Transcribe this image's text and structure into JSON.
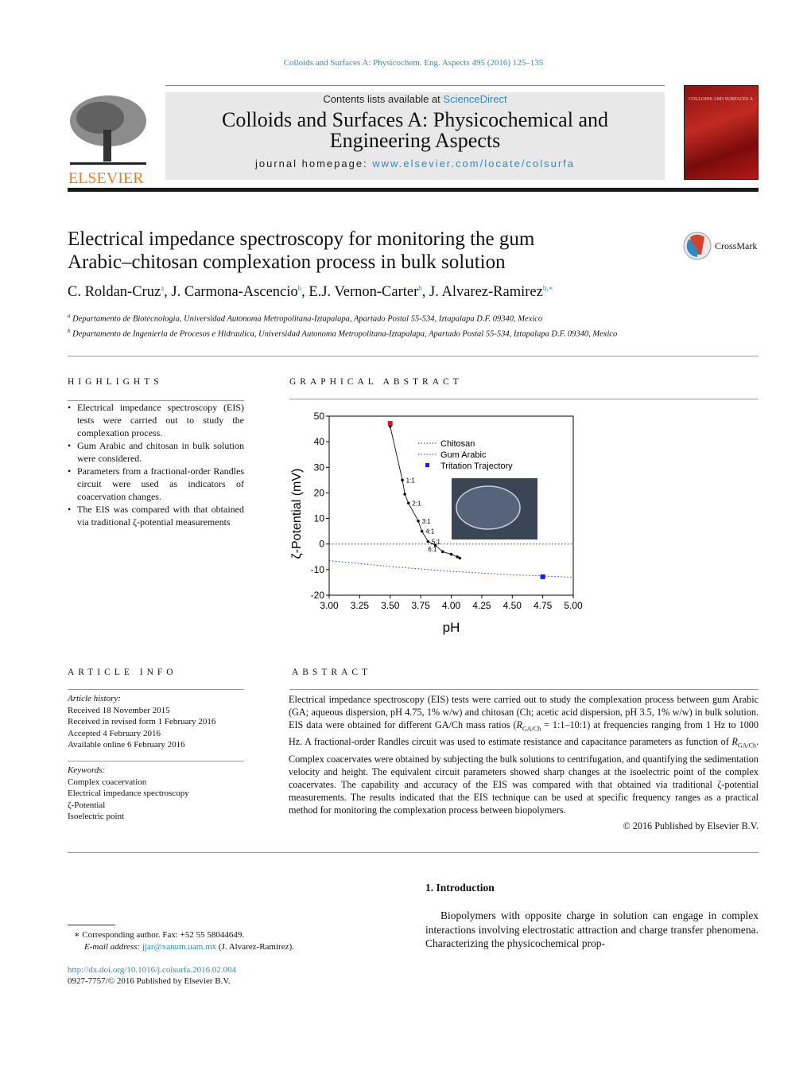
{
  "running_header": "Colloids and Surfaces A: Physicochem. Eng. Aspects 495 (2016) 125–135",
  "masthead": {
    "contents_prefix": "Contents lists available at ",
    "sciencedirect": "ScienceDirect",
    "journal_title_line1": "Colloids and Surfaces A: Physicochemical and",
    "journal_title_line2": "Engineering Aspects",
    "homepage_prefix": "journal homepage: ",
    "homepage_url": "www.elsevier.com/locate/colsurfa",
    "publisher_logo": "ELSEVIER",
    "cover_title": "COLLOIDS AND SURFACES A"
  },
  "crossmark": "CrossMark",
  "article": {
    "title_line1": "Electrical impedance spectroscopy for monitoring the gum",
    "title_line2": "Arabic–chitosan complexation process in bulk solution",
    "authors": [
      {
        "name": "C. Roldan-Cruz",
        "aff": "a",
        "sep": ", "
      },
      {
        "name": "J. Carmona-Ascencio",
        "aff": "b",
        "sep": ", "
      },
      {
        "name": "E.J. Vernon-Carter",
        "aff": "b",
        "sep": ", "
      },
      {
        "name": "J. Alvarez-Ramirez",
        "aff": "b,∗",
        "sep": ""
      }
    ],
    "affiliations": [
      {
        "mark": "a",
        "text": "Departamento de Biotecnologia, Universidad Autonoma Metropolitana-Iztapalapa, Apartado Postal 55-534, Iztapalapa D.F. 09340, Mexico"
      },
      {
        "mark": "b",
        "text": "Departamento de Ingenieria de Procesos e Hidraulica, Universidad Autonoma Metropolitana-Iztapalapa, Apartado Postal 55-534, Iztapalapa D.F. 09340, Mexico"
      }
    ]
  },
  "highlights": {
    "heading": "HIGHLIGHTS",
    "items": [
      "Electrical impedance spectroscopy (EIS) tests were carried out to study the complexation process.",
      "Gum Arabic and chitosan in bulk solution were considered.",
      "Parameters from a fractional-order Randles circuit were used as indicators of coacervation changes.",
      "The EIS was compared with that obtained via traditional ζ-potential measurements"
    ]
  },
  "graphical_abstract": {
    "heading": "GRAPHICAL ABSTRACT"
  },
  "chart_data": {
    "type": "line",
    "xlabel": "pH",
    "ylabel": "ζ-Potential (mV)",
    "xlim": [
      3.0,
      5.0
    ],
    "ylim": [
      -20,
      50
    ],
    "xticks": [
      "3.00",
      "3.25",
      "3.50",
      "3.75",
      "4.00",
      "4.25",
      "4.50",
      "4.75",
      "5.00"
    ],
    "yticks": [
      "50",
      "40",
      "30",
      "20",
      "10",
      "0",
      "-10",
      "-20"
    ],
    "grid": false,
    "legend_placement": "top-right",
    "legend": [
      "Chitosan",
      "Gum Arabic",
      "Tritation Trajectory"
    ],
    "series": [
      {
        "name": "Chitosan",
        "style": "dotted",
        "color": "#333333",
        "x": [
          3.0,
          5.0
        ],
        "y": [
          0,
          0
        ]
      },
      {
        "name": "Gum Arabic",
        "style": "dotted",
        "color": "#2233dd",
        "x": [
          3.0,
          3.5,
          4.0,
          4.5,
          5.0
        ],
        "y": [
          -6.5,
          -8.8,
          -10.7,
          -12.0,
          -13.0
        ]
      },
      {
        "name": "Tritation Trajectory",
        "color": "#1a1aee",
        "x": [
          4.75
        ],
        "y": [
          -12.8
        ]
      },
      {
        "name": "chitosan start",
        "color": "#ee1111",
        "x": [
          3.5
        ],
        "y": [
          47.2
        ]
      },
      {
        "style": "solid",
        "color": "#111111",
        "x": [
          3.5,
          3.6,
          3.62,
          3.65,
          3.73,
          3.76,
          3.81,
          3.87,
          3.93,
          4.0,
          4.05,
          4.07
        ],
        "y": [
          46,
          25,
          19.5,
          16,
          9,
          5,
          1,
          -0.5,
          -3,
          -4,
          -5,
          -5.5
        ]
      }
    ],
    "annotations": [
      {
        "text": "1:1",
        "x": 3.61,
        "y": 25
      },
      {
        "text": "2:1",
        "x": 3.66,
        "y": 16
      },
      {
        "text": "3:1",
        "x": 3.74,
        "y": 9
      },
      {
        "text": "4:1",
        "x": 3.77,
        "y": 5
      },
      {
        "text": "5:1",
        "x": 3.82,
        "y": 1
      },
      {
        "text": "6:1",
        "x": 3.79,
        "y": -2
      }
    ]
  },
  "article_info": {
    "heading": "ARTICLE INFO",
    "history_label": "Article history:",
    "history": [
      "Received 18 November 2015",
      "Received in revised form 1 February 2016",
      "Accepted 4 February 2016",
      "Available online 6 February 2016"
    ],
    "keywords_label": "Keywords:",
    "keywords": [
      "Complex coacervation",
      "Electrical impedance spectroscopy",
      "ζ-Potential",
      "Isoelectric point"
    ]
  },
  "abstract": {
    "heading": "ABSTRACT",
    "part1": "Electrical impedance spectroscopy (EIS) tests were carried out to study the complexation process between gum Arabic (GA; aqueous dispersion, pH 4.75, 1% w/w) and chitosan (Ch; acetic acid dispersion, pH 3.5, 1% w/w) in bulk solution. EIS data were obtained for different GA/Ch mass ratios (",
    "r": "R",
    "r_sub": "GA/Ch",
    "part2": " = 1:1–10:1) at frequencies ranging from 1 Hz to 1000 Hz. A fractional-order Randles circuit was used to estimate resistance and capacitance parameters as function of ",
    "part3": ". Complex coacervates were obtained by subjecting the bulk solutions to centrifugation, and quantifying the sedimentation velocity and height. The equivalent circuit parameters showed sharp changes at the isoelectric point of the complex coacervates. The capability and accuracy of the EIS was compared with that obtained via traditional ζ-potential measurements. The results indicated that the EIS technique can be used at specific frequency ranges as a practical method for monitoring the complexation process between biopolymers.",
    "copyright": "© 2016 Published by Elsevier B.V."
  },
  "introduction": {
    "heading": "1.  Introduction",
    "text": "Biopolymers with opposite charge in solution can engage in complex interactions involving electrostatic attraction and charge transfer phenomena. Characterizing the physicochemical prop-"
  },
  "footnote": {
    "corresponding": "∗  Corresponding author. Fax: +52 55 58044649.",
    "email_label": "E-mail address: ",
    "email": "jjar@xanum.uam.mx",
    "email_suffix": " (J. Alvarez-Ramirez).",
    "doi": "http://dx.doi.org/10.1016/j.colsurfa.2016.02.004",
    "issn": "0927-7757/© 2016 Published by Elsevier B.V."
  }
}
